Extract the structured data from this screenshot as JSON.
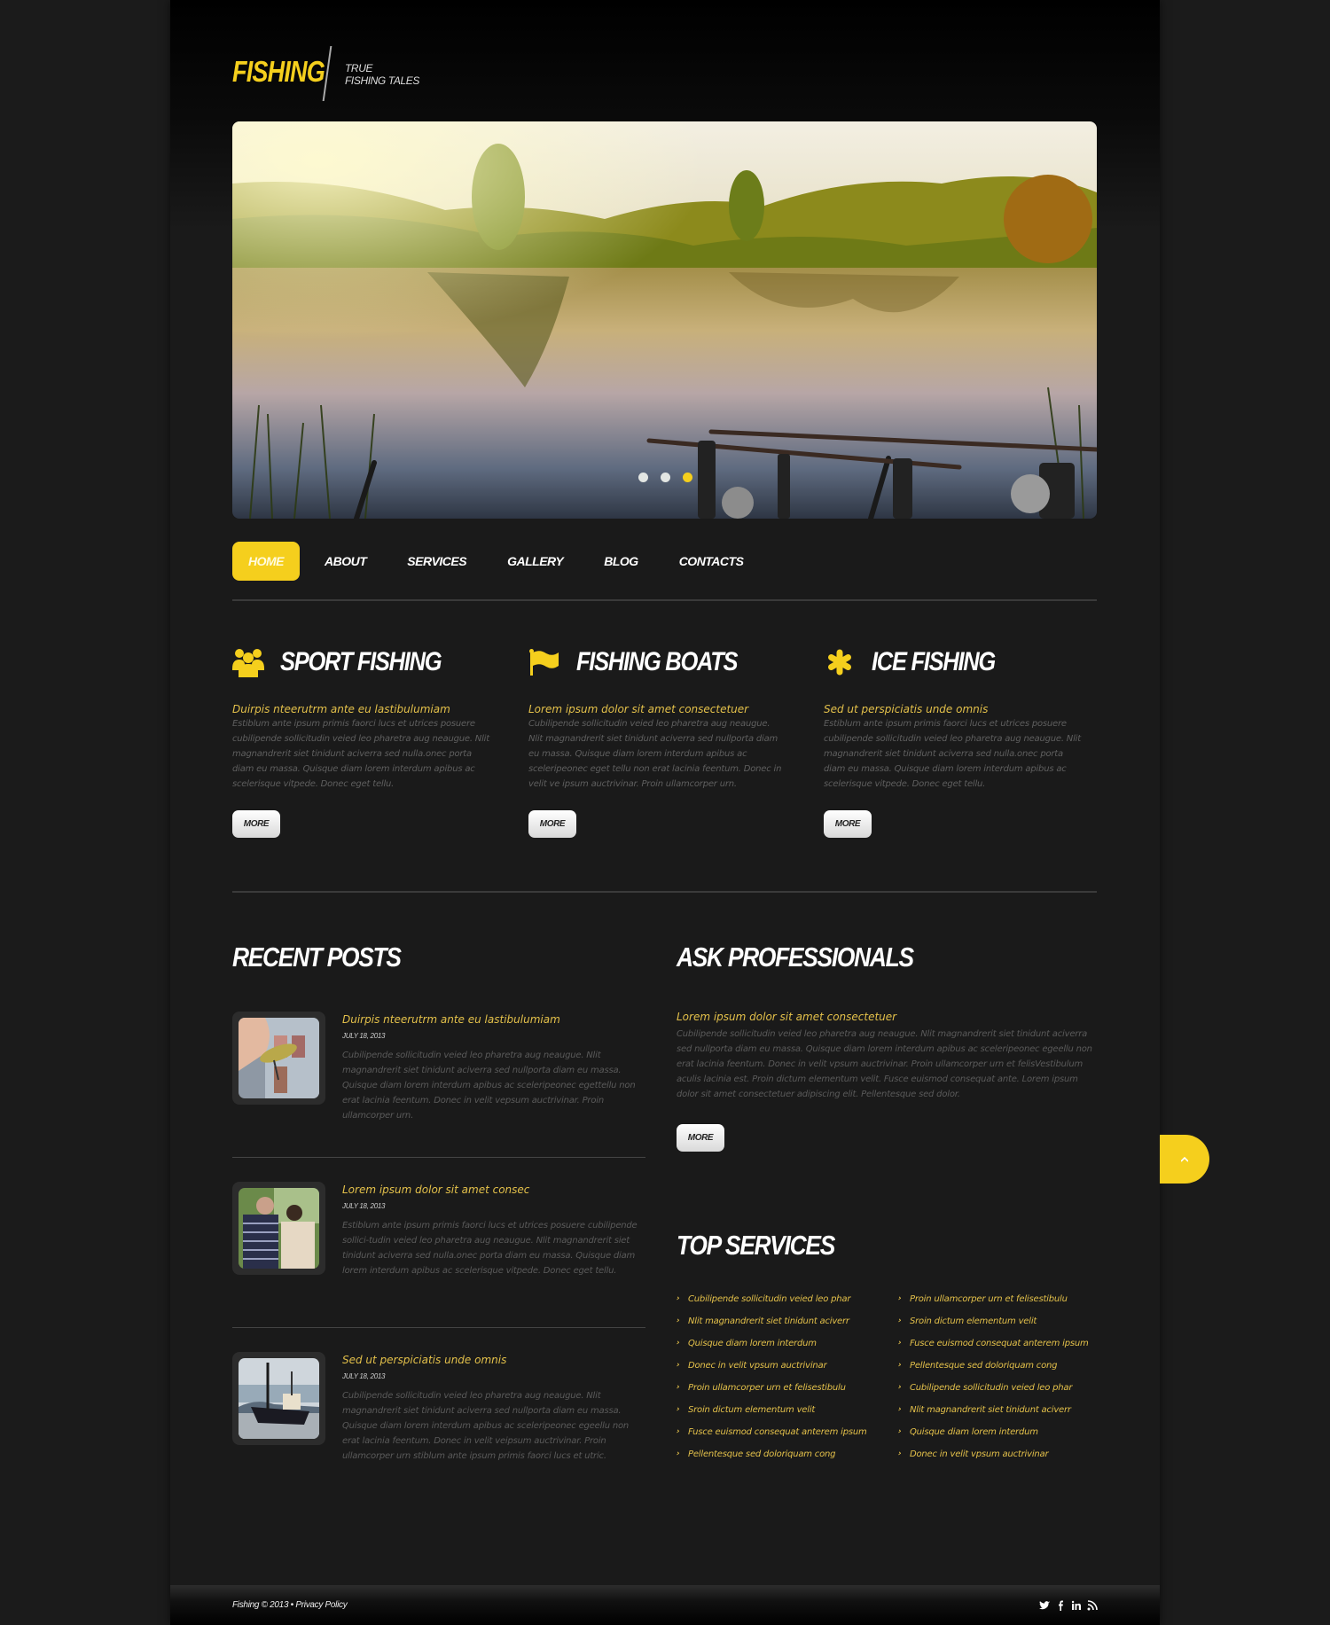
{
  "brand": {
    "logo": "FISHING",
    "tagline_line1": "TRUE",
    "tagline_line2": "FISHING TALES",
    "accent_color": "#f5cf1d"
  },
  "slider": {
    "slide_count": 3,
    "active_slide": 3,
    "scene": "lake at sunset with fishing rods"
  },
  "nav": {
    "items": [
      {
        "label": "HOME",
        "active": true
      },
      {
        "label": "ABOUT",
        "active": false
      },
      {
        "label": "SERVICES",
        "active": false
      },
      {
        "label": "GALLERY",
        "active": false
      },
      {
        "label": "BLOG",
        "active": false
      },
      {
        "label": "CONTACTS",
        "active": false
      }
    ]
  },
  "features": [
    {
      "icon": "group-icon",
      "title": "SPORT FISHING",
      "subtitle": "Duirpis nteerutrm ante eu lastibulumiam",
      "body": "Estiblum ante ipsum primis faorci lucs et utrices posuere cubilipende sollicitudin veied leo pharetra aug neaugue. Nlit magnandrerit siet tinidunt aciverra sed nulla.onec porta diam eu massa. Quisque diam lorem interdum apibus ac scelerisque vitpede. Donec eget tellu.",
      "button": "MORE"
    },
    {
      "icon": "flag-icon",
      "title": "FISHING BOATS",
      "subtitle": "Lorem ipsum dolor sit amet consectetuer",
      "body": "Cubilipende sollicitudin veied leo pharetra aug neaugue. Nlit magnandrerit siet tinidunt aciverra sed nullporta diam eu massa. Quisque diam lorem interdum apibus ac sceleripeonec eget tellu non erat lacinia feentum. Donec in velit ve ipsum auctrivinar. Proin ullamcorper urn.",
      "button": "MORE"
    },
    {
      "icon": "asterisk-icon",
      "title": "ICE FISHING",
      "subtitle": "Sed ut perspiciatis unde omnis",
      "body": "Estiblum ante ipsum primis faorci lucs et utrices posuere cubilipende sollicitudin veied leo pharetra aug neaugue. Nlit magnandrerit siet tinidunt aciverra sed nulla.onec porta diam eu massa. Quisque diam lorem interdum apibus ac scelerisque vitpede. Donec eget tellu.",
      "button": "MORE"
    }
  ],
  "recent_posts": {
    "title": "RECENT POSTS",
    "posts": [
      {
        "thumb": "fishing lure",
        "title": "Duirpis nteerutrm ante eu lastibulumiam",
        "date": "JULY 18, 2013",
        "body": "Cubilipende sollicitudin veied leo pharetra aug neaugue. Nlit magnandrerit siet tinidunt aciverra sed nullporta diam eu massa. Quisque diam lorem interdum apibus ac sceleripeonec egettellu non erat lacinia feentum. Donec in velit vepsum auctrivinar. Proin ullamcorper urn."
      },
      {
        "thumb": "two men sitting",
        "title": "Lorem ipsum dolor sit amet consec",
        "date": "JULY 18, 2013",
        "body": "Estiblum ante ipsum primis faorci lucs et utrices posuere cubilipende sollici-tudin veied leo pharetra aug neaugue. Nlit magnandrerit siet tinidunt aciverra sed nulla.onec porta diam eu massa. Quisque diam lorem interdum apibus ac scelerisque vitpede. Donec eget tellu."
      },
      {
        "thumb": "fishing boat",
        "title": "Sed ut perspiciatis unde omnis",
        "date": "JULY 18, 2013",
        "body": "Cubilipende sollicitudin veied leo pharetra aug neaugue. Nlit magnandrerit siet tinidunt aciverra sed nullporta diam eu massa. Quisque diam lorem interdum apibus ac sceleripeonec egeellu non erat lacinia feentum. Donec in velit veipsum auctrivinar. Proin ullamcorper urn stiblum ante ipsum primis faorci lucs et utric."
      }
    ]
  },
  "ask": {
    "title": "ASK PROFESSIONALS",
    "subtitle": "Lorem ipsum dolor sit amet consectetuer",
    "body": "Cubilipende sollicitudin veied leo pharetra aug neaugue. Nlit magnandrerit siet tinidunt aciverra sed nullporta diam eu massa. Quisque diam lorem interdum apibus ac sceleripeonec egeellu non erat lacinia feentum. Donec in velit vpsum auctrivinar. Proin ullamcorper urn et felisVestibulum aculis lacinia est. Proin dictum elementum velit. Fusce euismod consequat ante. Lorem ipsum dolor sit amet consectetuer adipiscing elit. Pellentesque sed dolor.",
    "button": "MORE"
  },
  "top_services": {
    "title": "TOP SERVICES",
    "col1": [
      "Cubilipende sollicitudin veied leo phar",
      "Nlit magnandrerit siet tinidunt aciverr",
      "Quisque diam lorem interdum",
      "Donec in velit vpsum auctrivinar",
      "Proin ullamcorper urn et felisestibulu",
      "Sroin dictum elementum velit",
      "Fusce euismod consequat anterem ipsum",
      "Pellentesque sed doloriquam cong"
    ],
    "col2": [
      "Proin ullamcorper urn et felisestibulu",
      "Sroin dictum elementum velit",
      "Fusce euismod consequat anterem ipsum",
      "Pellentesque sed doloriquam cong",
      "Cubilipende sollicitudin veied leo phar",
      "Nlit magnandrerit siet tinidunt aciverr",
      "Quisque diam lorem interdum",
      "Donec in velit vpsum auctrivinar"
    ]
  },
  "footer": {
    "copyright": "Fishing © 2013 •",
    "privacy": "Privacy Policy",
    "social": [
      "twitter-icon",
      "facebook-icon",
      "linkedin-icon",
      "rss-icon"
    ]
  },
  "back_to_top": {
    "icon": "chevron-up-icon"
  }
}
